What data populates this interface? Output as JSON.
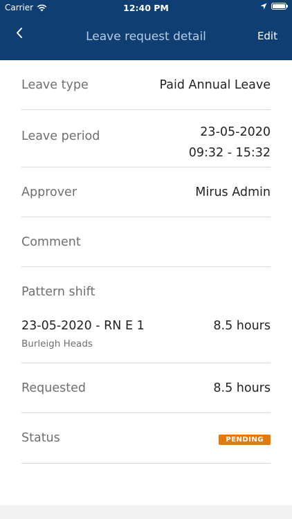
{
  "status_bar": {
    "carrier": "Carrier",
    "time": "12:40 PM"
  },
  "nav": {
    "title": "Leave request detail",
    "edit_label": "Edit"
  },
  "details": {
    "leave_type": {
      "label": "Leave type",
      "value": "Paid Annual Leave"
    },
    "leave_period": {
      "label": "Leave period",
      "date": "23-05-2020",
      "time": "09:32 - 15:32"
    },
    "approver": {
      "label": "Approver",
      "value": "Mirus Admin"
    },
    "comment": {
      "label": "Comment"
    },
    "pattern_shift": {
      "label": "Pattern shift",
      "shift_name": "23-05-2020 - RN E 1",
      "location": "Burleigh Heads",
      "hours": "8.5 hours"
    },
    "requested": {
      "label": "Requested",
      "value": "8.5 hours"
    },
    "status": {
      "label": "Status",
      "badge": "PENDING",
      "badge_color": "#e07a13"
    }
  },
  "colors": {
    "header": "#0f3f72",
    "title": "#b7cbe4"
  }
}
